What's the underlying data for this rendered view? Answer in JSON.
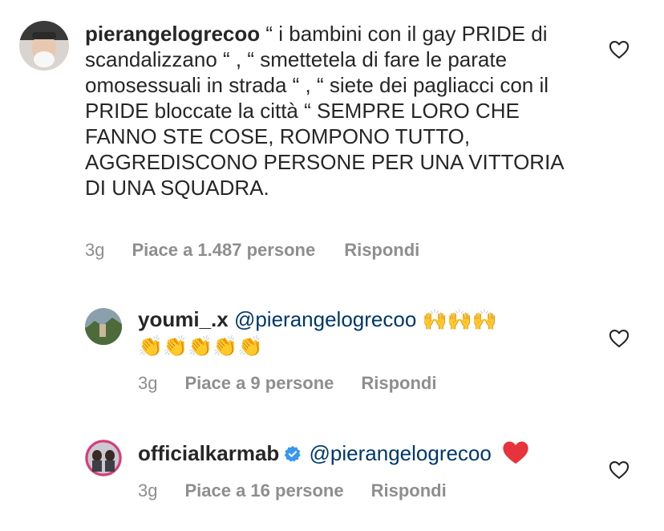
{
  "comments": [
    {
      "username": "pierangelogrecoo",
      "text": " “ i bambini con il gay PRIDE di scandalizzano “ , “ smettetela di fare le parate omosessuali in strada “ , “ siete dei pagliacci con il PRIDE bloccate la città “ SEMPRE LORO CHE FANNO STE COSE, ROMPONO TUTTO, AGGREDISCONO PERSONE PER UNA VITTORIA DI UNA SQUADRA.",
      "time": "3g",
      "likes": "Piace a 1.487 persone",
      "reply": "Rispondi"
    },
    {
      "username": "youmi_.x",
      "mention": "@pierangelogrecoo",
      "emoji_line1": "🙌🙌🙌",
      "emoji_line2": "👏👏👏👏👏",
      "time": "3g",
      "likes": "Piace a 9 persone",
      "reply": "Rispondi"
    },
    {
      "username": "officialkarmab",
      "verified": true,
      "mention": "@pierangelogrecoo",
      "emoji": "❤️",
      "time": "3g",
      "likes": "Piace a 16 persone",
      "reply": "Rispondi"
    }
  ],
  "icons": {
    "like": "heart-outline-icon",
    "verified": "verified-badge-icon",
    "red_heart": "red-heart-emoji"
  },
  "colors": {
    "text": "#262626",
    "meta": "#8e8e8e",
    "mention": "#00376b",
    "verified": "#3897f0",
    "heart": "#ed4956"
  }
}
